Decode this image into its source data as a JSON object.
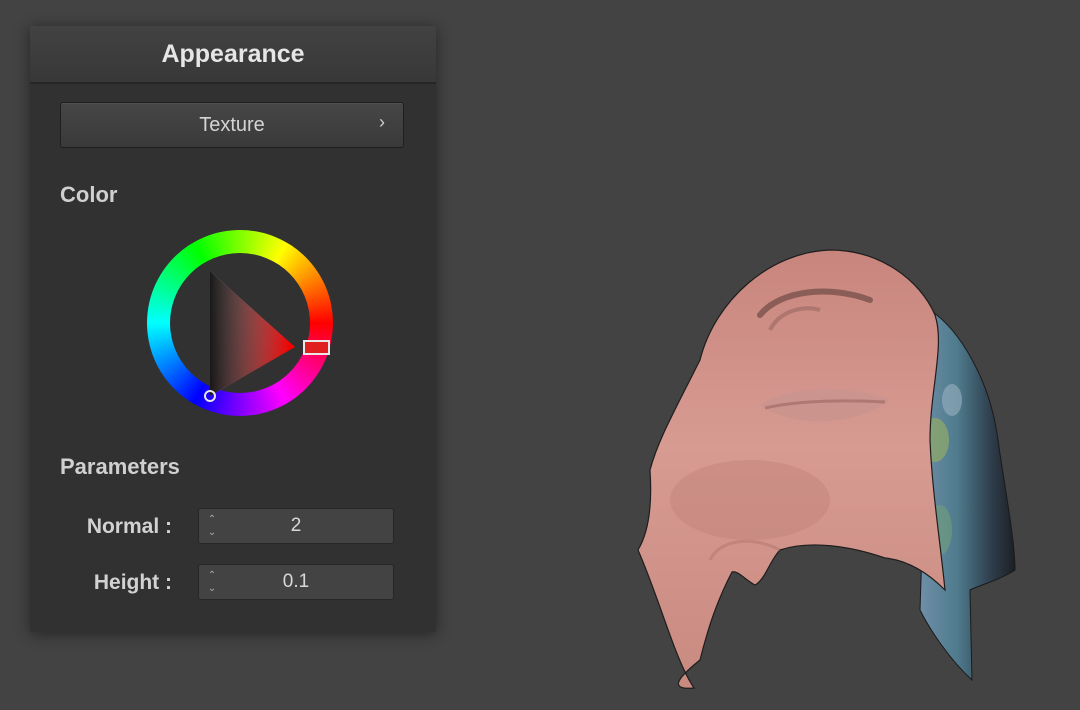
{
  "panel": {
    "title": "Appearance",
    "texture_button": {
      "label": "Texture",
      "chevron_icon": "chevron-right-icon"
    },
    "color_section": {
      "label": "Color",
      "selected_hue_color": "#ff0000"
    },
    "parameters_section": {
      "label": "Parameters",
      "fields": [
        {
          "label": "Normal :",
          "value": "2"
        },
        {
          "label": "Height :",
          "value": "0.1"
        }
      ]
    }
  },
  "colors": {
    "viewport_bg": "#434343",
    "panel_bg": "#313131",
    "header_bg": "#3c3c3c",
    "text": "#d0d0d0"
  }
}
